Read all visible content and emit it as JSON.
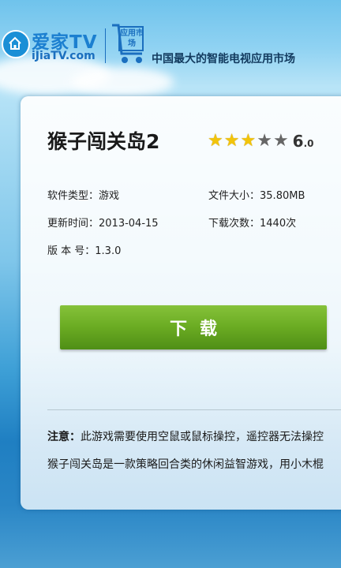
{
  "header": {
    "brand_cn": "爱家TV",
    "brand_url": "iJiaTV.com",
    "cart_text": "应用市场",
    "slogan": "中国最大的智能电视应用市场"
  },
  "app": {
    "title": "猴子闯关岛2",
    "rating_stars": 3,
    "rating_max": 5,
    "score_main": "6",
    "score_sub": ".0",
    "category_label": "软件类型：",
    "category": "游戏",
    "size_label": "文件大小：",
    "size": "35.80MB",
    "updated_label": "更新时间：",
    "updated": "2013-04-15",
    "downloads_label": "下载次数：",
    "downloads": "1440次",
    "version_label": "版 本 号：",
    "version": "1.3.0"
  },
  "download_button": "下载",
  "notes": {
    "note_label": "注意：",
    "note_text": "此游戏需要使用空鼠或鼠标操控，遥控器无法操控",
    "description": "猴子闯关岛是一款策略回合类的休闲益智游戏，用小木棍"
  },
  "colors": {
    "button_green": "#6aab22",
    "star_yellow": "#f2c40a",
    "brand_blue": "#1b7fd0"
  }
}
